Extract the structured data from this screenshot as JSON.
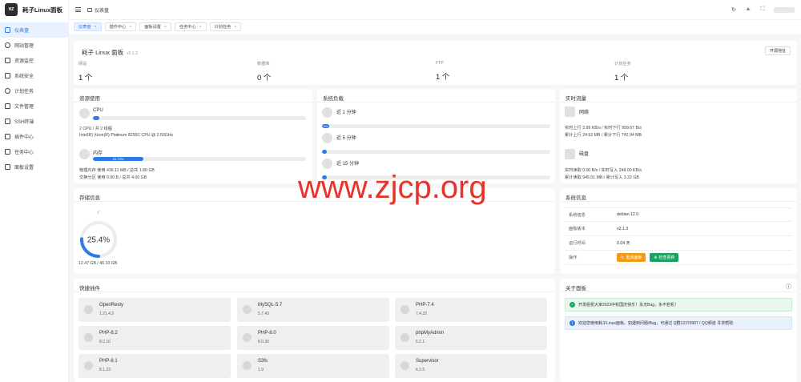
{
  "brand": {
    "name": "耗子Linux面板",
    "logo_text": "HZ"
  },
  "sidebar": {
    "items": [
      {
        "label": "仪表盘",
        "icon": "dashboard-icon",
        "active": true
      },
      {
        "label": "网站管理",
        "icon": "globe-icon"
      },
      {
        "label": "资源监控",
        "icon": "monitor-icon"
      },
      {
        "label": "系统安全",
        "icon": "shield-icon"
      },
      {
        "label": "计划任务",
        "icon": "clock-icon"
      },
      {
        "label": "文件管理",
        "icon": "folder-icon"
      },
      {
        "label": "SSH终端",
        "icon": "terminal-icon"
      },
      {
        "label": "插件中心",
        "icon": "plugin-icon"
      },
      {
        "label": "任务中心",
        "icon": "task-icon"
      },
      {
        "label": "面板设置",
        "icon": "gear-icon"
      }
    ]
  },
  "header": {
    "breadcrumb": "仪表盘",
    "icons": [
      "refresh-icon",
      "theme-icon",
      "fullscreen-icon"
    ]
  },
  "tabs": [
    {
      "label": "仪表盘",
      "active": true
    },
    {
      "label": "插件中心"
    },
    {
      "label": "面板设置"
    },
    {
      "label": "任务中心"
    },
    {
      "label": "计划任务"
    }
  ],
  "overview": {
    "title": "耗子 Linux 面板",
    "version": "v2.1.3",
    "button": "开源地址",
    "stats": [
      {
        "label": "网站",
        "value": "1 个"
      },
      {
        "label": "数据库",
        "value": "0 个"
      },
      {
        "label": "FTP",
        "value": "1 个"
      },
      {
        "label": "计划任务",
        "value": "1 个"
      }
    ]
  },
  "resources": {
    "title": "资源使用",
    "cpu": {
      "name": "CPU",
      "percent": 2,
      "line1": "2 CPU / 共 2 线程",
      "line2": "Intel(R) Xeon(R) Platinum 8255C CPU @ 2.50GHz"
    },
    "mem": {
      "name": "内存",
      "percent": 23.72,
      "percent_label": "23.72%",
      "line1": "物理内存 使用 436.11 MB / 总共 1.80 GB",
      "line2": "交换分区 使用 0.00 B / 总共 4.00 GB"
    }
  },
  "load": {
    "title": "系统负载",
    "items": [
      {
        "name": "近 1 分钟",
        "percent": 3,
        "label": "3%"
      },
      {
        "name": "近 5 分钟",
        "percent": 1,
        "label": ""
      },
      {
        "name": "近 15 分钟",
        "percent": 1,
        "label": ""
      }
    ]
  },
  "traffic": {
    "title": "实时流量",
    "net": {
      "name": "网络",
      "line1": "实时上行 3.99 KB/s / 实时下行 959.67 B/s",
      "line2": "累计上行 24.62 MB / 累计下行 742.94 MB"
    },
    "disk": {
      "name": "磁盘",
      "line1": "实时读取 0.00 B/s / 实时写入 248.00 KB/s",
      "line2": "累计读取 945.51 MB / 累计写入 3.22 GB"
    }
  },
  "storage": {
    "title": "存储信息",
    "mount": "/",
    "percent": 25.4,
    "percent_label": "25.4%",
    "usage": "12.47 GB / 49.10 GB"
  },
  "sysinfo": {
    "title": "系统信息",
    "rows": [
      {
        "key": "系统信息",
        "value": "debian 12.0"
      },
      {
        "key": "面板版本",
        "value": "v2.1.3"
      },
      {
        "key": "运行时间",
        "value": "0.04 天"
      }
    ],
    "action_label": "操作",
    "restart_btn": "重启面板",
    "update_btn": "检查更新"
  },
  "plugins": {
    "title": "快捷插件",
    "items": [
      {
        "name": "OpenResty",
        "version": "1.21.4.2"
      },
      {
        "name": "MySQL-5.7",
        "version": "5.7.43"
      },
      {
        "name": "PHP-7.4",
        "version": "7.4.33"
      },
      {
        "name": "PHP-8.2",
        "version": "8.2.10"
      },
      {
        "name": "PHP-8.0",
        "version": "8.0.30"
      },
      {
        "name": "phpMyAdmin",
        "version": "5.2.1"
      },
      {
        "name": "PHP-8.1",
        "version": "8.1.23"
      },
      {
        "name": "S3fs",
        "version": "1.9"
      },
      {
        "name": "Supervisor",
        "version": "4.2.5"
      }
    ]
  },
  "about": {
    "title": "关于面板",
    "alerts": [
      {
        "type": "success",
        "text": "开发组祝大家2023中秋国庆快乐！永无Bug，永不宕机！"
      },
      {
        "type": "info",
        "text": "欢迎您使用耗子Linux面板。如遇到问题/Bug，可通过 Q群12370907 / QQ频道 寻求帮助"
      }
    ]
  },
  "watermark": "www.zjcp.org",
  "colors": {
    "primary": "#2d7be5",
    "orange": "#f39c12",
    "green": "#1aa260",
    "watermark": "#e8322a"
  }
}
